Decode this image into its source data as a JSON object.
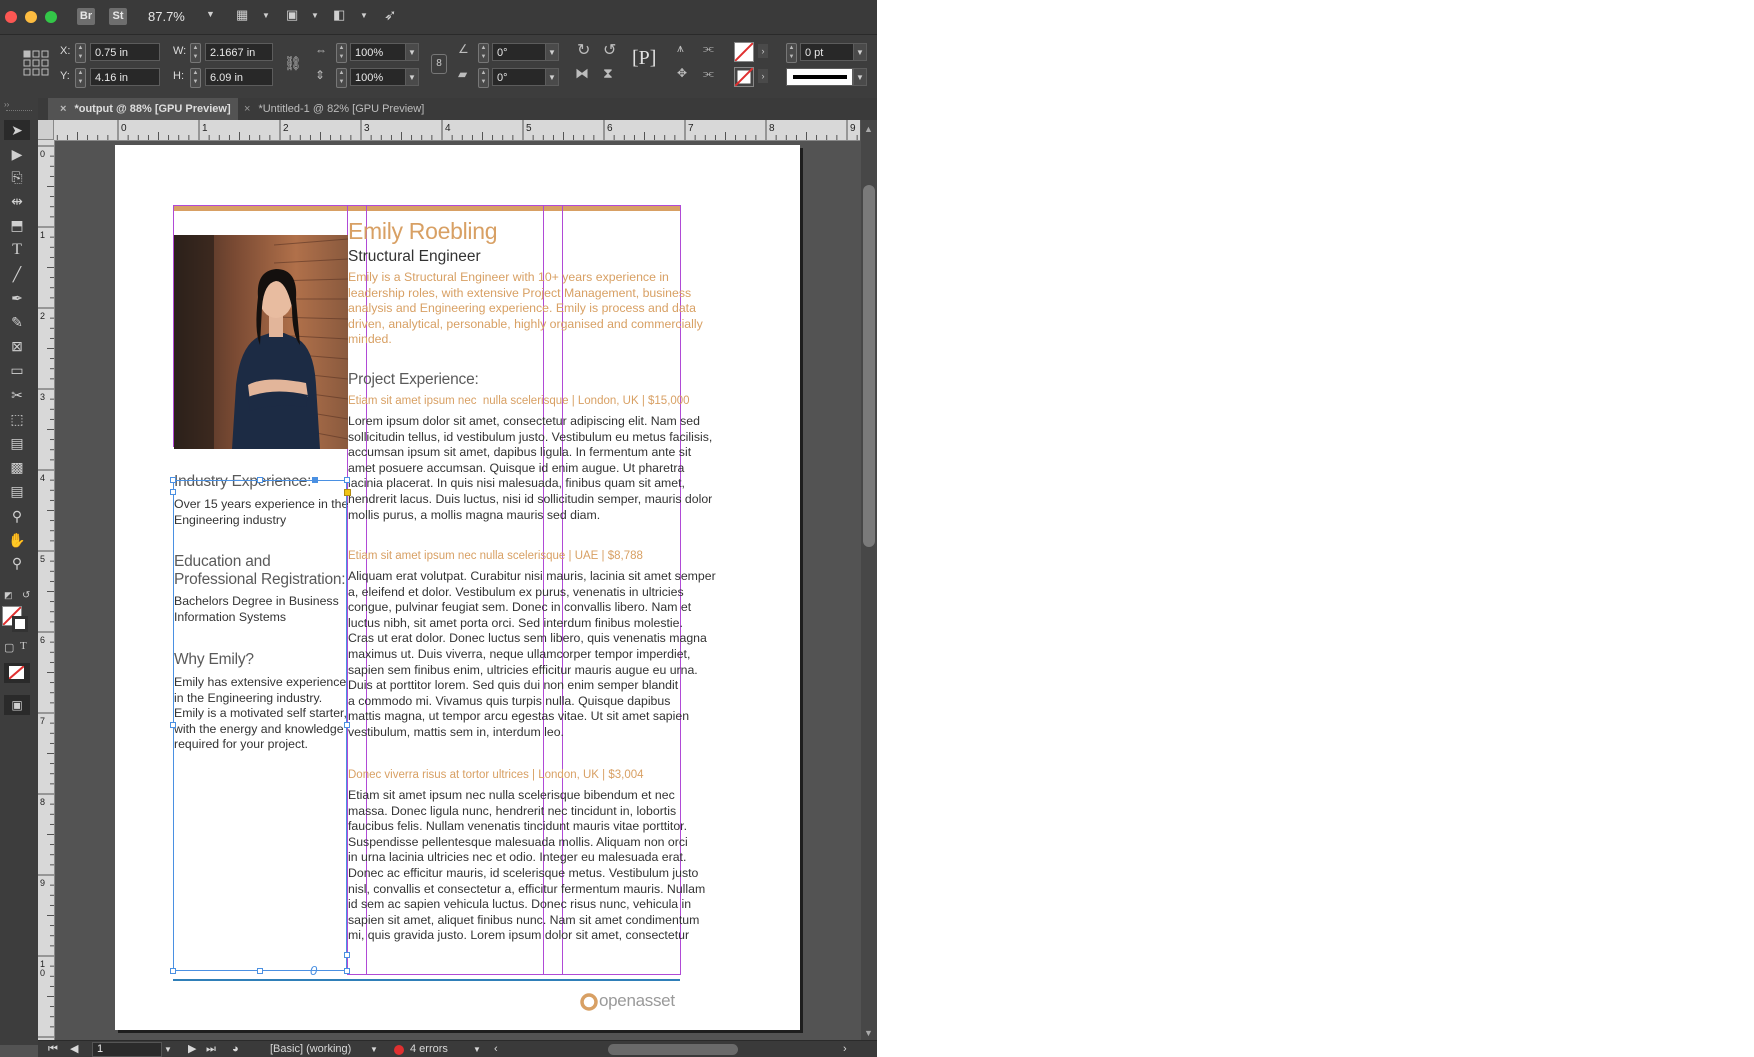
{
  "toolbar_top": {
    "badges": [
      "Br",
      "St"
    ],
    "zoom": "87.7%"
  },
  "control": {
    "x_label": "X:",
    "x_value": "0.75 in",
    "y_label": "Y:",
    "y_value": "4.16 in",
    "w_label": "W:",
    "w_value": "2.1667 in",
    "h_label": "H:",
    "h_value": "6.09 in",
    "scale_x": "100%",
    "scale_y": "100%",
    "rotate": "0°",
    "shear": "0°",
    "stroke_weight": "0 pt"
  },
  "tabs": [
    {
      "label": "*output @ 88% [GPU Preview]"
    },
    {
      "label": "*Untitled-1 @ 82% [GPU Preview]"
    }
  ],
  "ruler_h": [
    "0",
    "1",
    "2",
    "3",
    "4",
    "5",
    "6",
    "7",
    "8",
    "9"
  ],
  "ruler_v": [
    "0",
    "1",
    "2",
    "3",
    "4",
    "5",
    "6",
    "7",
    "8",
    "9",
    "10"
  ],
  "document": {
    "name": "Emily Roebling",
    "title": "Structural Engineer",
    "intro": [
      "Emily is a Structural Engineer with 10+ years experience in",
      "leadership roles, with extensive Project Management, business",
      "analysis and Engineering experience. Emily is process and data",
      "driven, analytical, personable, highly organised and commercially",
      "minded."
    ],
    "project_heading": "Project Experience:",
    "projects": [
      {
        "title": "Etiam sit amet ipsum nec  nulla scelerisque | London, UK | $15,000",
        "lines": [
          "Lorem ipsum dolor sit amet, consectetur adipiscing elit. Nam sed",
          "sollicitudin tellus, id vestibulum justo. Vestibulum eu metus facilisis,",
          "accumsan ipsum sit amet, dapibus ligula. In fermentum ante sit",
          "amet posuere accumsan. Quisque id enim augue. Ut pharetra",
          "lacinia placerat. In quis nisi malesuada, finibus quam sit amet,",
          "hendrerit lacus. Duis luctus, nisi id sollicitudin semper, mauris dolor",
          "mollis purus, a mollis magna mauris sed diam."
        ]
      },
      {
        "title": "Etiam sit amet ipsum nec nulla scelerisque | UAE | $8,788",
        "lines": [
          "Aliquam erat volutpat. Curabitur nisi mauris, lacinia sit amet semper",
          "a, eleifend et dolor. Vestibulum ex purus, venenatis in ultricies",
          "congue, pulvinar feugiat sem. Donec in convallis libero. Nam et",
          "luctus nibh, sit amet porta orci. Sed interdum finibus molestie.",
          "Cras ut erat dolor. Donec luctus sem libero, quis venenatis magna",
          "maximus ut. Duis viverra, neque ullamcorper tempor imperdiet,",
          "sapien sem finibus enim, ultricies efficitur mauris augue eu urna.",
          "Duis at porttitor lorem. Sed quis dui non enim semper blandit",
          "a commodo mi. Vivamus quis turpis nulla. Quisque dapibus",
          "mattis magna, ut tempor arcu egestas vitae. Ut sit amet sapien",
          "vestibulum, mattis sem in, interdum leo."
        ]
      },
      {
        "title": "Donec viverra risus at tortor ultrices | London, UK | $3,004",
        "lines": [
          "Etiam sit amet ipsum nec nulla scelerisque bibendum et nec",
          "massa. Donec ligula nunc, hendrerit nec tincidunt in, lobortis",
          "faucibus felis. Nullam venenatis tincidunt mauris vitae porttitor.",
          "Suspendisse pellentesque malesuada mollis. Aliquam non orci",
          "in urna lacinia ultricies nec et odio. Integer eu malesuada erat.",
          "Donec ac efficitur mauris, id scelerisque metus. Vestibulum justo",
          "nisl, convallis et consectetur a, efficitur fermentum mauris. Nullam",
          "id sem ac sapien vehicula luctus. Donec risus nunc, vehicula in",
          "sapien sit amet, aliquet finibus nunc. Nam sit amet condimentum",
          "mi, quis gravida justo. Lorem ipsum dolor sit amet, consectetur"
        ]
      }
    ],
    "industry_heading": "Industry Experience:",
    "industry_lines": [
      "Over 15 years experience in the",
      "Engineering industry"
    ],
    "education_heading": [
      "Education and",
      "Professional Registration:"
    ],
    "education_lines": [
      "Bachelors Degree in Business",
      "Information Systems"
    ],
    "why_heading": "Why Emily?",
    "why_lines": [
      "Emily has extensive experience",
      "in the Engineering industry.",
      "Emily is a motivated self starter,",
      "with the energy and knowledge",
      "required for your project."
    ],
    "logo_text": "openasset"
  },
  "status": {
    "page": "1",
    "profile": "[Basic] (working)",
    "errors": "4 errors"
  },
  "colors": {
    "accent_orange": "#d8a064",
    "guide_purple": "#b04ad6",
    "selection_blue": "#4a90e2",
    "error_red": "#e03030",
    "footer_rule": "#2f7fb8"
  }
}
